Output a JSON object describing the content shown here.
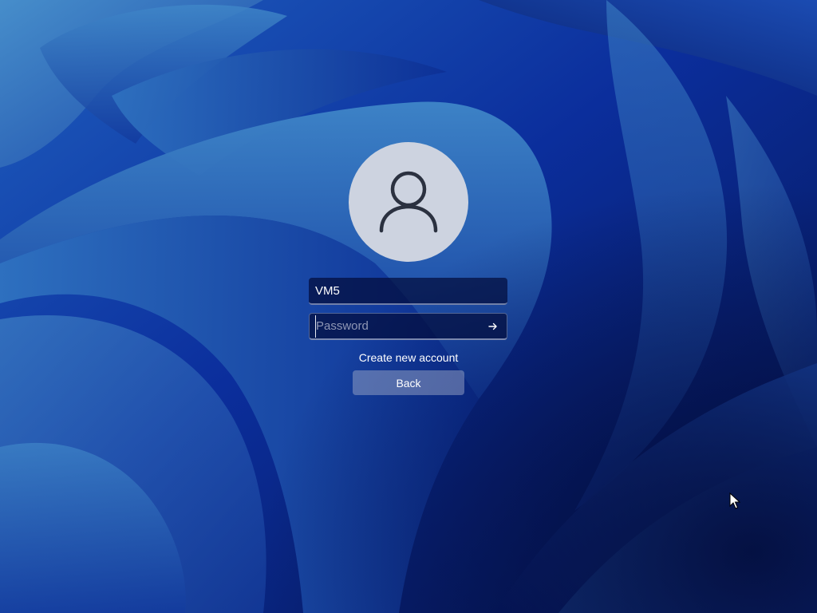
{
  "login": {
    "username": "VM5",
    "password_placeholder": "Password",
    "create_account_label": "Create new account",
    "back_label": "Back"
  },
  "icons": {
    "avatar": "user-icon",
    "submit": "arrow-right-icon",
    "cursor": "mouse-pointer-icon"
  },
  "colors": {
    "wallpaper_primary": "#0a2a8a",
    "wallpaper_highlight": "#3b7ec4",
    "avatar_bg": "#cdd3e0",
    "avatar_glyph": "#2b3140"
  }
}
